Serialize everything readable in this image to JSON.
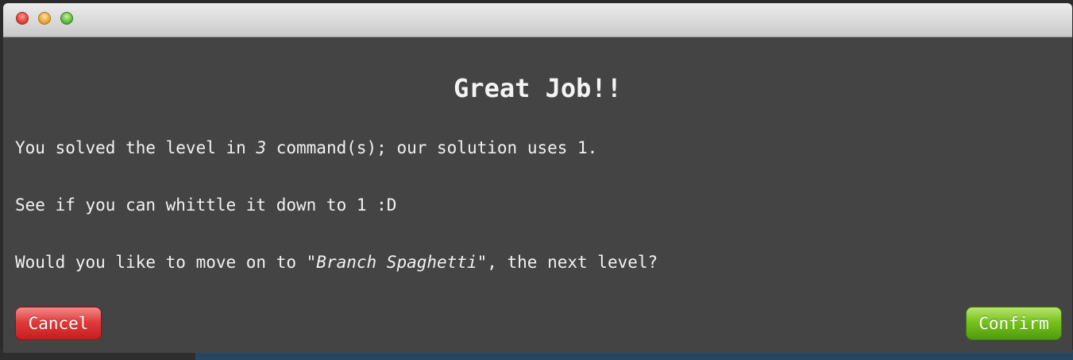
{
  "dialog": {
    "title": "Great Job!!",
    "line1": {
      "before": "You solved the level in ",
      "count": "3",
      "after": " command(s); our solution uses 1."
    },
    "line2": "See if you can whittle it down to 1 :D",
    "line3": {
      "before": "Would you like to move on to ",
      "level_name": "\"Branch Spaghetti\"",
      "after": ", the next level?"
    },
    "cancel_label": "Cancel",
    "confirm_label": "Confirm"
  },
  "colors": {
    "dialog_bg": "#444444",
    "cancel": "#d62c2c",
    "confirm": "#6cb81a"
  }
}
